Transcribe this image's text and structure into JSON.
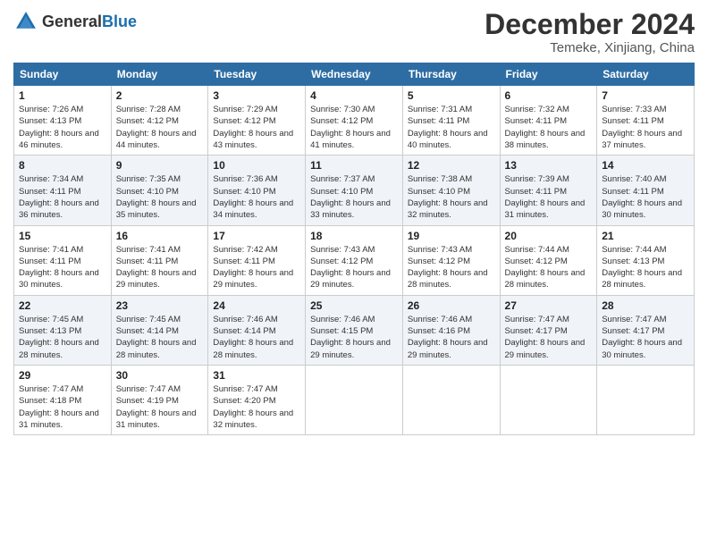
{
  "logo": {
    "general": "General",
    "blue": "Blue"
  },
  "header": {
    "month": "December 2024",
    "location": "Temeke, Xinjiang, China"
  },
  "weekdays": [
    "Sunday",
    "Monday",
    "Tuesday",
    "Wednesday",
    "Thursday",
    "Friday",
    "Saturday"
  ],
  "weeks": [
    [
      {
        "day": "1",
        "sunrise": "Sunrise: 7:26 AM",
        "sunset": "Sunset: 4:13 PM",
        "daylight": "Daylight: 8 hours and 46 minutes."
      },
      {
        "day": "2",
        "sunrise": "Sunrise: 7:28 AM",
        "sunset": "Sunset: 4:12 PM",
        "daylight": "Daylight: 8 hours and 44 minutes."
      },
      {
        "day": "3",
        "sunrise": "Sunrise: 7:29 AM",
        "sunset": "Sunset: 4:12 PM",
        "daylight": "Daylight: 8 hours and 43 minutes."
      },
      {
        "day": "4",
        "sunrise": "Sunrise: 7:30 AM",
        "sunset": "Sunset: 4:12 PM",
        "daylight": "Daylight: 8 hours and 41 minutes."
      },
      {
        "day": "5",
        "sunrise": "Sunrise: 7:31 AM",
        "sunset": "Sunset: 4:11 PM",
        "daylight": "Daylight: 8 hours and 40 minutes."
      },
      {
        "day": "6",
        "sunrise": "Sunrise: 7:32 AM",
        "sunset": "Sunset: 4:11 PM",
        "daylight": "Daylight: 8 hours and 38 minutes."
      },
      {
        "day": "7",
        "sunrise": "Sunrise: 7:33 AM",
        "sunset": "Sunset: 4:11 PM",
        "daylight": "Daylight: 8 hours and 37 minutes."
      }
    ],
    [
      {
        "day": "8",
        "sunrise": "Sunrise: 7:34 AM",
        "sunset": "Sunset: 4:11 PM",
        "daylight": "Daylight: 8 hours and 36 minutes."
      },
      {
        "day": "9",
        "sunrise": "Sunrise: 7:35 AM",
        "sunset": "Sunset: 4:10 PM",
        "daylight": "Daylight: 8 hours and 35 minutes."
      },
      {
        "day": "10",
        "sunrise": "Sunrise: 7:36 AM",
        "sunset": "Sunset: 4:10 PM",
        "daylight": "Daylight: 8 hours and 34 minutes."
      },
      {
        "day": "11",
        "sunrise": "Sunrise: 7:37 AM",
        "sunset": "Sunset: 4:10 PM",
        "daylight": "Daylight: 8 hours and 33 minutes."
      },
      {
        "day": "12",
        "sunrise": "Sunrise: 7:38 AM",
        "sunset": "Sunset: 4:10 PM",
        "daylight": "Daylight: 8 hours and 32 minutes."
      },
      {
        "day": "13",
        "sunrise": "Sunrise: 7:39 AM",
        "sunset": "Sunset: 4:11 PM",
        "daylight": "Daylight: 8 hours and 31 minutes."
      },
      {
        "day": "14",
        "sunrise": "Sunrise: 7:40 AM",
        "sunset": "Sunset: 4:11 PM",
        "daylight": "Daylight: 8 hours and 30 minutes."
      }
    ],
    [
      {
        "day": "15",
        "sunrise": "Sunrise: 7:41 AM",
        "sunset": "Sunset: 4:11 PM",
        "daylight": "Daylight: 8 hours and 30 minutes."
      },
      {
        "day": "16",
        "sunrise": "Sunrise: 7:41 AM",
        "sunset": "Sunset: 4:11 PM",
        "daylight": "Daylight: 8 hours and 29 minutes."
      },
      {
        "day": "17",
        "sunrise": "Sunrise: 7:42 AM",
        "sunset": "Sunset: 4:11 PM",
        "daylight": "Daylight: 8 hours and 29 minutes."
      },
      {
        "day": "18",
        "sunrise": "Sunrise: 7:43 AM",
        "sunset": "Sunset: 4:12 PM",
        "daylight": "Daylight: 8 hours and 29 minutes."
      },
      {
        "day": "19",
        "sunrise": "Sunrise: 7:43 AM",
        "sunset": "Sunset: 4:12 PM",
        "daylight": "Daylight: 8 hours and 28 minutes."
      },
      {
        "day": "20",
        "sunrise": "Sunrise: 7:44 AM",
        "sunset": "Sunset: 4:12 PM",
        "daylight": "Daylight: 8 hours and 28 minutes."
      },
      {
        "day": "21",
        "sunrise": "Sunrise: 7:44 AM",
        "sunset": "Sunset: 4:13 PM",
        "daylight": "Daylight: 8 hours and 28 minutes."
      }
    ],
    [
      {
        "day": "22",
        "sunrise": "Sunrise: 7:45 AM",
        "sunset": "Sunset: 4:13 PM",
        "daylight": "Daylight: 8 hours and 28 minutes."
      },
      {
        "day": "23",
        "sunrise": "Sunrise: 7:45 AM",
        "sunset": "Sunset: 4:14 PM",
        "daylight": "Daylight: 8 hours and 28 minutes."
      },
      {
        "day": "24",
        "sunrise": "Sunrise: 7:46 AM",
        "sunset": "Sunset: 4:14 PM",
        "daylight": "Daylight: 8 hours and 28 minutes."
      },
      {
        "day": "25",
        "sunrise": "Sunrise: 7:46 AM",
        "sunset": "Sunset: 4:15 PM",
        "daylight": "Daylight: 8 hours and 29 minutes."
      },
      {
        "day": "26",
        "sunrise": "Sunrise: 7:46 AM",
        "sunset": "Sunset: 4:16 PM",
        "daylight": "Daylight: 8 hours and 29 minutes."
      },
      {
        "day": "27",
        "sunrise": "Sunrise: 7:47 AM",
        "sunset": "Sunset: 4:17 PM",
        "daylight": "Daylight: 8 hours and 29 minutes."
      },
      {
        "day": "28",
        "sunrise": "Sunrise: 7:47 AM",
        "sunset": "Sunset: 4:17 PM",
        "daylight": "Daylight: 8 hours and 30 minutes."
      }
    ],
    [
      {
        "day": "29",
        "sunrise": "Sunrise: 7:47 AM",
        "sunset": "Sunset: 4:18 PM",
        "daylight": "Daylight: 8 hours and 31 minutes."
      },
      {
        "day": "30",
        "sunrise": "Sunrise: 7:47 AM",
        "sunset": "Sunset: 4:19 PM",
        "daylight": "Daylight: 8 hours and 31 minutes."
      },
      {
        "day": "31",
        "sunrise": "Sunrise: 7:47 AM",
        "sunset": "Sunset: 4:20 PM",
        "daylight": "Daylight: 8 hours and 32 minutes."
      },
      null,
      null,
      null,
      null
    ]
  ]
}
